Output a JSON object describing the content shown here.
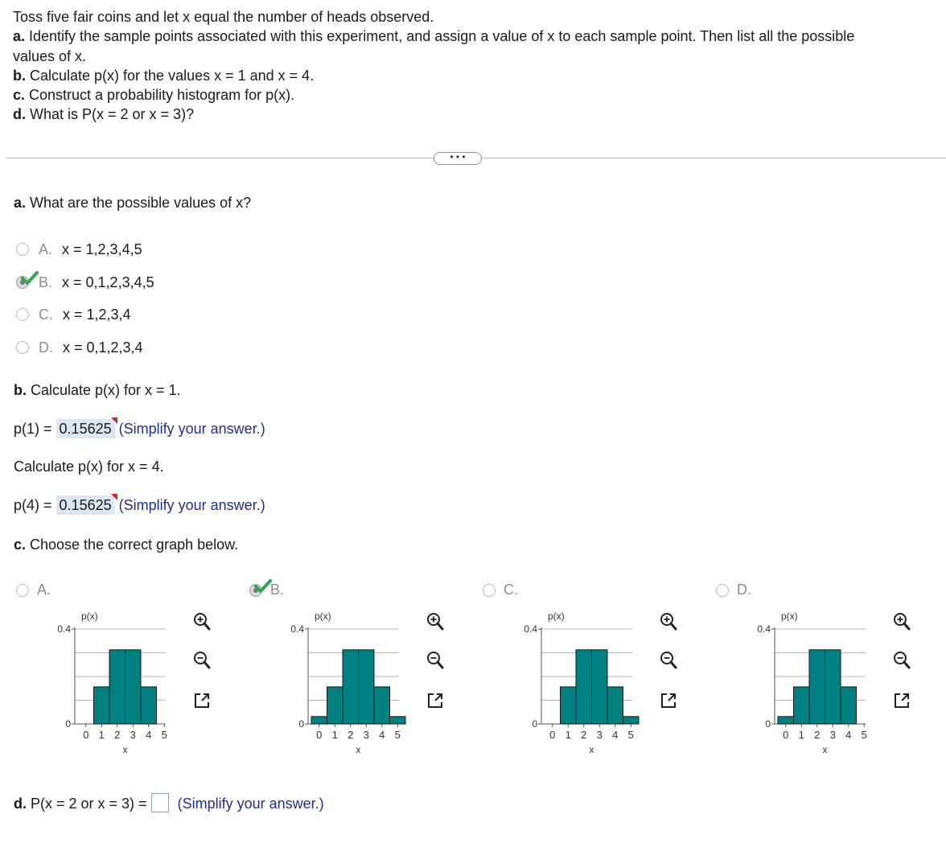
{
  "question": {
    "line1": "Toss five fair coins and let x equal the number of heads observed.",
    "a_label": "a.",
    "a_text": " Identify the sample points associated with this experiment, and assign a value of x to each sample point. Then list all the possible",
    "a_text2": "values of x.",
    "b_label": "b.",
    "b_text": " Calculate p(x) for the values x = 1 and x = 4.",
    "c_label": "c.",
    "c_text": " Construct a probability histogram for p(x).",
    "d_label": "d.",
    "d_text": " What is P(x = 2 or x = 3)?"
  },
  "more_button": "• • •",
  "part_a": {
    "label": "a.",
    "prompt": " What are the possible values of x?",
    "options": [
      {
        "letter": "A.",
        "text": "x = 1,2,3,4,5",
        "selected": false
      },
      {
        "letter": "B.",
        "text": "x = 0,1,2,3,4,5",
        "selected": true
      },
      {
        "letter": "C.",
        "text": "x = 1,2,3,4",
        "selected": false
      },
      {
        "letter": "D.",
        "text": "x = 0,1,2,3,4",
        "selected": false
      }
    ]
  },
  "part_b": {
    "label": "b.",
    "prompt1": " Calculate p(x) for x = 1.",
    "p1_label": "p(1) =",
    "p1_value": "0.15625",
    "hint": "(Simplify your answer.)",
    "prompt2": "Calculate p(x) for x = 4.",
    "p4_label": "p(4) =",
    "p4_value": "0.15625"
  },
  "part_c": {
    "label": "c.",
    "prompt": " Choose the correct graph below.",
    "options": [
      "A.",
      "B.",
      "C.",
      "D."
    ],
    "selected": "B."
  },
  "part_d": {
    "label": "d.",
    "prompt": " P(x = 2 or x = 3) =",
    "value": "",
    "hint": "(Simplify your answer.)"
  },
  "colors": {
    "bar": "#008080",
    "check": "#2fa84f",
    "hint": "#1f2f8f",
    "answer_bg": "#dde6f3"
  },
  "chart_data": [
    {
      "type": "bar",
      "option": "A.",
      "ylabel": "p(x)",
      "xlabel": "x",
      "yticks": [
        "0",
        "0.4"
      ],
      "ylim": [
        0,
        0.4
      ],
      "categories": [
        "0",
        "1",
        "2",
        "3",
        "4",
        "5"
      ],
      "values": [
        0,
        0.15625,
        0.3125,
        0.3125,
        0.15625,
        0
      ],
      "grid": true
    },
    {
      "type": "bar",
      "option": "B.",
      "ylabel": "p(x)",
      "xlabel": "x",
      "yticks": [
        "0",
        "0.4"
      ],
      "ylim": [
        0,
        0.4
      ],
      "categories": [
        "0",
        "1",
        "2",
        "3",
        "4",
        "5"
      ],
      "values": [
        0.03125,
        0.15625,
        0.3125,
        0.3125,
        0.15625,
        0.03125
      ],
      "grid": true
    },
    {
      "type": "bar",
      "option": "C.",
      "ylabel": "p(x)",
      "xlabel": "x",
      "yticks": [
        "0",
        "0.4"
      ],
      "ylim": [
        0,
        0.4
      ],
      "categories": [
        "0",
        "1",
        "2",
        "3",
        "4",
        "5"
      ],
      "values": [
        0,
        0.15625,
        0.3125,
        0.3125,
        0.15625,
        0.03125
      ],
      "grid": true
    },
    {
      "type": "bar",
      "option": "D.",
      "ylabel": "p(x)",
      "xlabel": "x",
      "yticks": [
        "0",
        "0.4"
      ],
      "ylim": [
        0,
        0.4
      ],
      "categories": [
        "0",
        "1",
        "2",
        "3",
        "4",
        "5"
      ],
      "values": [
        0.03125,
        0.15625,
        0.3125,
        0.3125,
        0.15625,
        0
      ],
      "grid": true
    }
  ]
}
